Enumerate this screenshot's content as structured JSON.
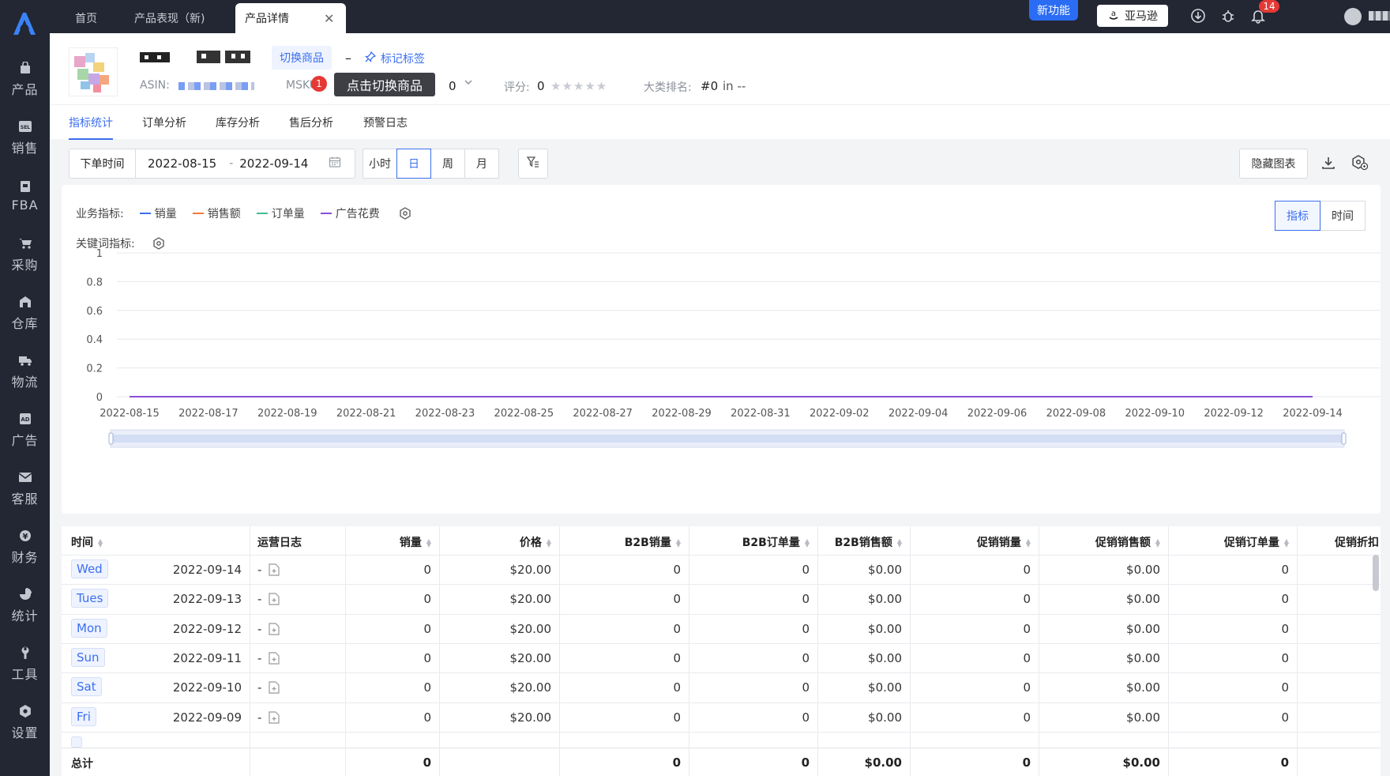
{
  "tabs": [
    {
      "label": "首页"
    },
    {
      "label": "产品表现（新)"
    },
    {
      "label": "产品详情"
    }
  ],
  "topbar": {
    "new_feature": "新功能",
    "marketplace": "亚马逊",
    "notification_count": "14"
  },
  "sidebar": {
    "items": [
      {
        "label": "产品",
        "icon": "bag-icon"
      },
      {
        "label": "销售",
        "icon": "sell-icon"
      },
      {
        "label": "FBA",
        "icon": "fba-icon"
      },
      {
        "label": "采购",
        "icon": "cart-icon"
      },
      {
        "label": "仓库",
        "icon": "warehouse-icon"
      },
      {
        "label": "物流",
        "icon": "truck-icon"
      },
      {
        "label": "广告",
        "icon": "ad-icon"
      },
      {
        "label": "客服",
        "icon": "mail-icon"
      },
      {
        "label": "财务",
        "icon": "yen-icon"
      },
      {
        "label": "统计",
        "icon": "pie-icon"
      },
      {
        "label": "工具",
        "icon": "wrench-icon"
      },
      {
        "label": "设置",
        "icon": "gear-icon"
      }
    ]
  },
  "product": {
    "switch_label": "切换商品",
    "dash": "–",
    "tag_label": "标记标签",
    "asin_label": "ASIN:",
    "msku_label": "MSKU",
    "step_number": "1",
    "tooltip": "点击切换商品",
    "stock_value": "0",
    "rating_label": "评分:",
    "rating_value": "0",
    "rank_label": "大类排名:",
    "rank_value": "#0",
    "rank_suffix": "in --"
  },
  "subtabs": [
    "指标统计",
    "订单分析",
    "库存分析",
    "售后分析",
    "预警日志"
  ],
  "filters": {
    "date_type": "下单时间",
    "start_date": "2022-08-15",
    "separator": "-",
    "end_date": "2022-09-14",
    "granularity": [
      "小时",
      "日",
      "周",
      "月"
    ],
    "active_granularity": "日",
    "hide_chart": "隐藏图表"
  },
  "chart_panel": {
    "business_label": "业务指标:",
    "keyword_label": "关键词指标:",
    "mode_metric": "指标",
    "mode_time": "时间"
  },
  "colors": {
    "accent": "#3b6ff0",
    "sales_qty": "#3b6ff0",
    "sales_amt": "#f07b3b",
    "orders": "#3fbf8f",
    "ad_spend": "#8a4fd8"
  },
  "chart_data": {
    "type": "line",
    "x": [
      "2022-08-15",
      "2022-08-16",
      "2022-08-17",
      "2022-08-18",
      "2022-08-19",
      "2022-08-20",
      "2022-08-21",
      "2022-08-22",
      "2022-08-23",
      "2022-08-24",
      "2022-08-25",
      "2022-08-26",
      "2022-08-27",
      "2022-08-28",
      "2022-08-29",
      "2022-08-30",
      "2022-08-31",
      "2022-09-01",
      "2022-09-02",
      "2022-09-03",
      "2022-09-04",
      "2022-09-05",
      "2022-09-06",
      "2022-09-07",
      "2022-09-08",
      "2022-09-09",
      "2022-09-10",
      "2022-09-11",
      "2022-09-12",
      "2022-09-13",
      "2022-09-14"
    ],
    "xticks": [
      "2022-08-15",
      "2022-08-17",
      "2022-08-19",
      "2022-08-21",
      "2022-08-23",
      "2022-08-25",
      "2022-08-27",
      "2022-08-29",
      "2022-08-31",
      "2022-09-02",
      "2022-09-04",
      "2022-09-06",
      "2022-09-08",
      "2022-09-10",
      "2022-09-12",
      "2022-09-14"
    ],
    "yticks": [
      "1",
      "0.8",
      "0.6",
      "0.4",
      "0.2",
      "0"
    ],
    "ylim": [
      0,
      1
    ],
    "grid": true,
    "series": [
      {
        "name": "销量",
        "color": "#3b6ff0",
        "values": [
          0,
          0,
          0,
          0,
          0,
          0,
          0,
          0,
          0,
          0,
          0,
          0,
          0,
          0,
          0,
          0,
          0,
          0,
          0,
          0,
          0,
          0,
          0,
          0,
          0,
          0,
          0,
          0,
          0,
          0,
          0
        ]
      },
      {
        "name": "销售额",
        "color": "#f07b3b",
        "values": [
          0,
          0,
          0,
          0,
          0,
          0,
          0,
          0,
          0,
          0,
          0,
          0,
          0,
          0,
          0,
          0,
          0,
          0,
          0,
          0,
          0,
          0,
          0,
          0,
          0,
          0,
          0,
          0,
          0,
          0,
          0
        ]
      },
      {
        "name": "订单量",
        "color": "#3fbf8f",
        "values": [
          0,
          0,
          0,
          0,
          0,
          0,
          0,
          0,
          0,
          0,
          0,
          0,
          0,
          0,
          0,
          0,
          0,
          0,
          0,
          0,
          0,
          0,
          0,
          0,
          0,
          0,
          0,
          0,
          0,
          0,
          0
        ]
      },
      {
        "name": "广告花费",
        "color": "#8a4fd8",
        "values": [
          0,
          0,
          0,
          0,
          0,
          0,
          0,
          0,
          0,
          0,
          0,
          0,
          0,
          0,
          0,
          0,
          0,
          0,
          0,
          0,
          0,
          0,
          0,
          0,
          0,
          0,
          0,
          0,
          0,
          0,
          0
        ]
      }
    ]
  },
  "table": {
    "columns": [
      "时间",
      "运营日志",
      "销量",
      "价格",
      "B2B销量",
      "B2B订单量",
      "B2B销售额",
      "促销销量",
      "促销销售额",
      "促销订单量",
      "促销折扣"
    ],
    "rows": [
      {
        "day": "Wed",
        "date": "2022-09-14",
        "log": "-",
        "qty": "0",
        "price": "$20.00",
        "b2b_qty": "0",
        "b2b_orders": "0",
        "b2b_amt": "$0.00",
        "promo_qty": "0",
        "promo_amt": "$0.00",
        "promo_orders": "0"
      },
      {
        "day": "Tues",
        "date": "2022-09-13",
        "log": "-",
        "qty": "0",
        "price": "$20.00",
        "b2b_qty": "0",
        "b2b_orders": "0",
        "b2b_amt": "$0.00",
        "promo_qty": "0",
        "promo_amt": "$0.00",
        "promo_orders": "0"
      },
      {
        "day": "Mon",
        "date": "2022-09-12",
        "log": "-",
        "qty": "0",
        "price": "$20.00",
        "b2b_qty": "0",
        "b2b_orders": "0",
        "b2b_amt": "$0.00",
        "promo_qty": "0",
        "promo_amt": "$0.00",
        "promo_orders": "0"
      },
      {
        "day": "Sun",
        "date": "2022-09-11",
        "log": "-",
        "qty": "0",
        "price": "$20.00",
        "b2b_qty": "0",
        "b2b_orders": "0",
        "b2b_amt": "$0.00",
        "promo_qty": "0",
        "promo_amt": "$0.00",
        "promo_orders": "0"
      },
      {
        "day": "Sat",
        "date": "2022-09-10",
        "log": "-",
        "qty": "0",
        "price": "$20.00",
        "b2b_qty": "0",
        "b2b_orders": "0",
        "b2b_amt": "$0.00",
        "promo_qty": "0",
        "promo_amt": "$0.00",
        "promo_orders": "0"
      },
      {
        "day": "Fri",
        "date": "2022-09-09",
        "log": "-",
        "qty": "0",
        "price": "$20.00",
        "b2b_qty": "0",
        "b2b_orders": "0",
        "b2b_amt": "$0.00",
        "promo_qty": "0",
        "promo_amt": "$0.00",
        "promo_orders": "0"
      }
    ],
    "total": {
      "label": "总计",
      "qty": "0",
      "b2b_qty": "0",
      "b2b_orders": "0",
      "b2b_amt": "$0.00",
      "promo_qty": "0",
      "promo_amt": "$0.00",
      "promo_orders": "0"
    }
  }
}
